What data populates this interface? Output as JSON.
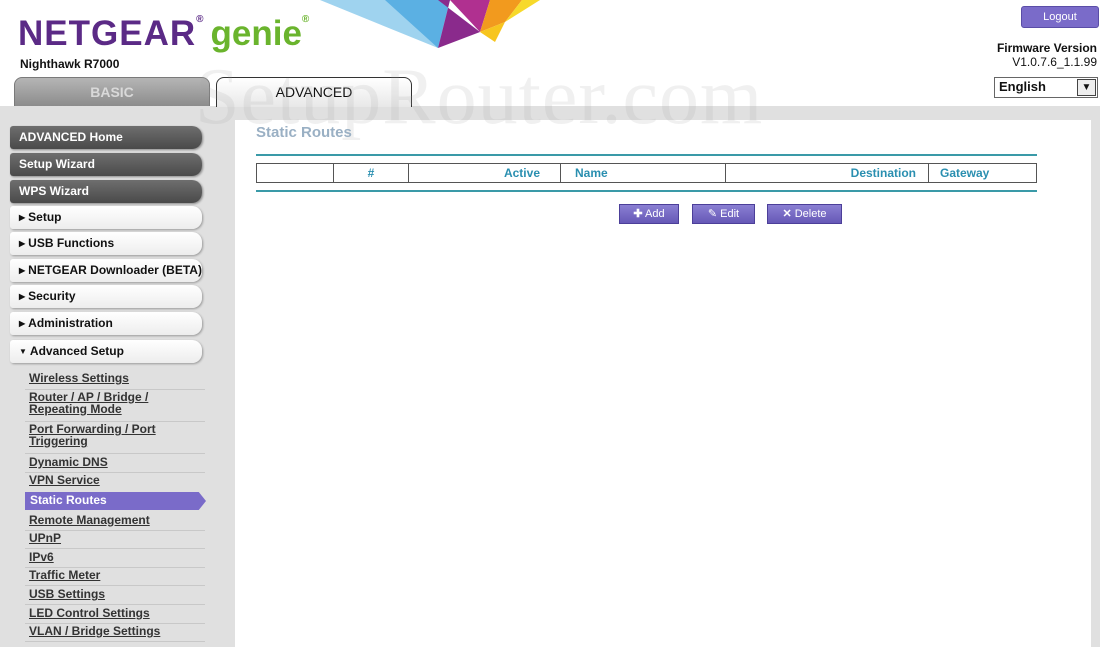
{
  "brand": {
    "name": "NETGEAR",
    "product": "genie",
    "reg_mark": "®",
    "model": "Nighthawk R7000"
  },
  "header": {
    "logout_label": "Logout",
    "firmware_label": "Firmware Version",
    "firmware_value": "V1.0.7.6_1.1.99",
    "language_selected": "English"
  },
  "tabs": {
    "basic": "BASIC",
    "advanced": "ADVANCED"
  },
  "sidebar": {
    "advanced_home": "ADVANCED Home",
    "setup_wizard": "Setup Wizard",
    "wps_wizard": "WPS Wizard",
    "sections": [
      "Setup",
      "USB Functions",
      "NETGEAR Downloader (BETA)",
      "Security",
      "Administration",
      "Advanced Setup"
    ],
    "advanced_items": {
      "wireless": "Wireless Settings",
      "router_ap_1": "Router / AP / Bridge /",
      "router_ap_2": "Repeating Mode",
      "port_fwd_1": "Port Forwarding / Port",
      "port_fwd_2": "Triggering",
      "ddns": "Dynamic DNS",
      "vpn": "VPN Service",
      "static_routes": "Static Routes",
      "remote_mgmt": "Remote Management",
      "upnp": "UPnP",
      "ipv6": "IPv6",
      "traffic_meter": "Traffic Meter",
      "usb_settings": "USB Settings",
      "led_control": "LED Control Settings",
      "vlan_bridge": "VLAN / Bridge Settings"
    }
  },
  "main": {
    "title": "Static Routes",
    "columns": [
      "",
      "#",
      "Active",
      "Name",
      "Destination",
      "Gateway"
    ],
    "buttons": {
      "add": "Add",
      "edit": "Edit",
      "delete": "Delete"
    }
  },
  "watermark": "SetupRouter.com",
  "colors": {
    "netgear_purple": "#5b2a86",
    "genie_green": "#6ab42d",
    "accent": "#7a6bc9",
    "teal": "#3a9aa8"
  }
}
